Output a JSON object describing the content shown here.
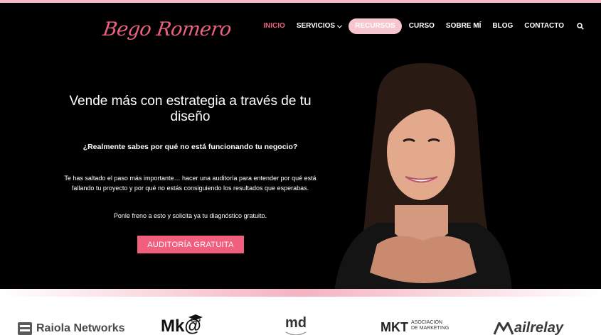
{
  "header": {
    "logo_text": "Bego Romero",
    "nav": [
      {
        "label": "INICIO",
        "state": "active"
      },
      {
        "label": "SERVICIOS",
        "has_dropdown": true
      },
      {
        "label": "RECURSOS",
        "state": "highlighted"
      },
      {
        "label": "CURSO"
      },
      {
        "label": "SOBRE MÍ"
      },
      {
        "label": "BLOG"
      },
      {
        "label": "CONTACTO"
      }
    ],
    "search_icon": "search-icon"
  },
  "hero": {
    "headline": "Vende más con estrategia a través de tu diseño",
    "question": "¿Realmente sabes por qué no está funcionando tu negocio?",
    "body": "Te has saltado el paso más importante… hacer una auditoría para entender por qué está fallando tu proyecto y por qué no estás consiguiendo los resultados que esperabas.",
    "body2": "Ponle freno a esto y solicita ya tu diagnóstico gratuito.",
    "cta_label": "AUDITORÍA GRATUITA"
  },
  "partners": {
    "raiola": "Raiola Networks",
    "mka": "Mk@",
    "md": "md",
    "mkt_short": "MKT",
    "mkt_line1": "ASOCIACIÓN",
    "mkt_line2": "DE MARKETING",
    "mailrelay": "ailrelay"
  },
  "colors": {
    "accent": "#f0607e",
    "pill": "#f7c5cf",
    "hero_bg": "#000000"
  }
}
